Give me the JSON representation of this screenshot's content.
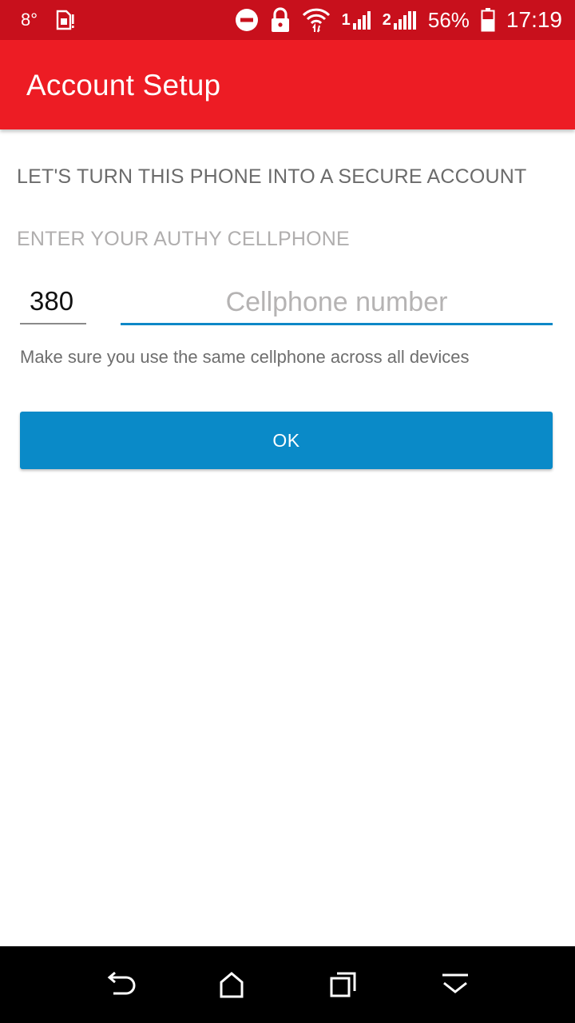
{
  "status_bar": {
    "temperature": "8°",
    "battery_percent": "56%",
    "time": "17:19",
    "signal_1_label": "1",
    "signal_2_label": "2",
    "icons": [
      "temperature",
      "sim-card-alert-icon",
      "do-not-disturb-icon",
      "lock-icon",
      "wifi-icon",
      "signal-icon",
      "signal-icon",
      "battery-icon"
    ]
  },
  "app_bar": {
    "title": "Account Setup",
    "color": "#ed1c24"
  },
  "main": {
    "headline": "LET'S TURN THIS PHONE INTO A SECURE ACCOUNT",
    "sub_label": "ENTER YOUR AUTHY CELLPHONE",
    "country_code": "380",
    "phone_placeholder": "Cellphone number",
    "phone_value": "",
    "hint": "Make sure you use the same cellphone across all devices",
    "ok_label": "OK",
    "accent_color": "#0a8ac8"
  },
  "nav_bar": {
    "buttons": [
      "back-icon",
      "home-icon",
      "recents-icon",
      "hide-keyboard-icon"
    ]
  }
}
